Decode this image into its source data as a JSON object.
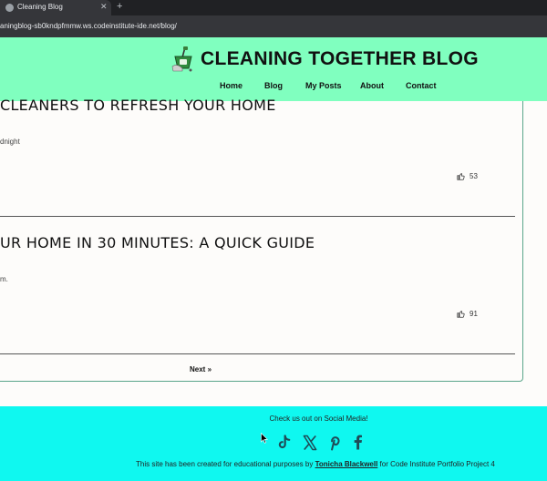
{
  "browser": {
    "tab_title": "Cleaning Blog",
    "tab_close": "✕",
    "new_tab": "+",
    "url": "aningblog-sb0kndpfmmw.ws.codeinstitute-ide.net/blog/"
  },
  "header": {
    "brand": "CLEANING TOGETHER BLOG",
    "nav": [
      "Home",
      "Blog",
      "My Posts",
      "About",
      "Contact"
    ]
  },
  "posts": [
    {
      "title": "CLEANERS TO REFRESH YOUR HOME",
      "excerpt": "dnight",
      "likes": "53"
    },
    {
      "title": "UR HOME IN 30 MINUTES: A QUICK GUIDE",
      "excerpt": "m.",
      "likes": "91"
    }
  ],
  "pagination": {
    "next": "Next »"
  },
  "footer": {
    "title": "Check us out on Social Media!",
    "social": [
      "tiktok-icon",
      "x-icon",
      "pinterest-icon",
      "facebook-icon"
    ],
    "credit_before": "This site has been created for educational purposes by ",
    "credit_author": "Tonicha Blackwell",
    "credit_after": " for Code Institute Portfolio Project 4"
  },
  "colors": {
    "header_bg": "#80ffbf",
    "footer_bg": "#0ff8f0",
    "card_border": "#5aa58a"
  }
}
